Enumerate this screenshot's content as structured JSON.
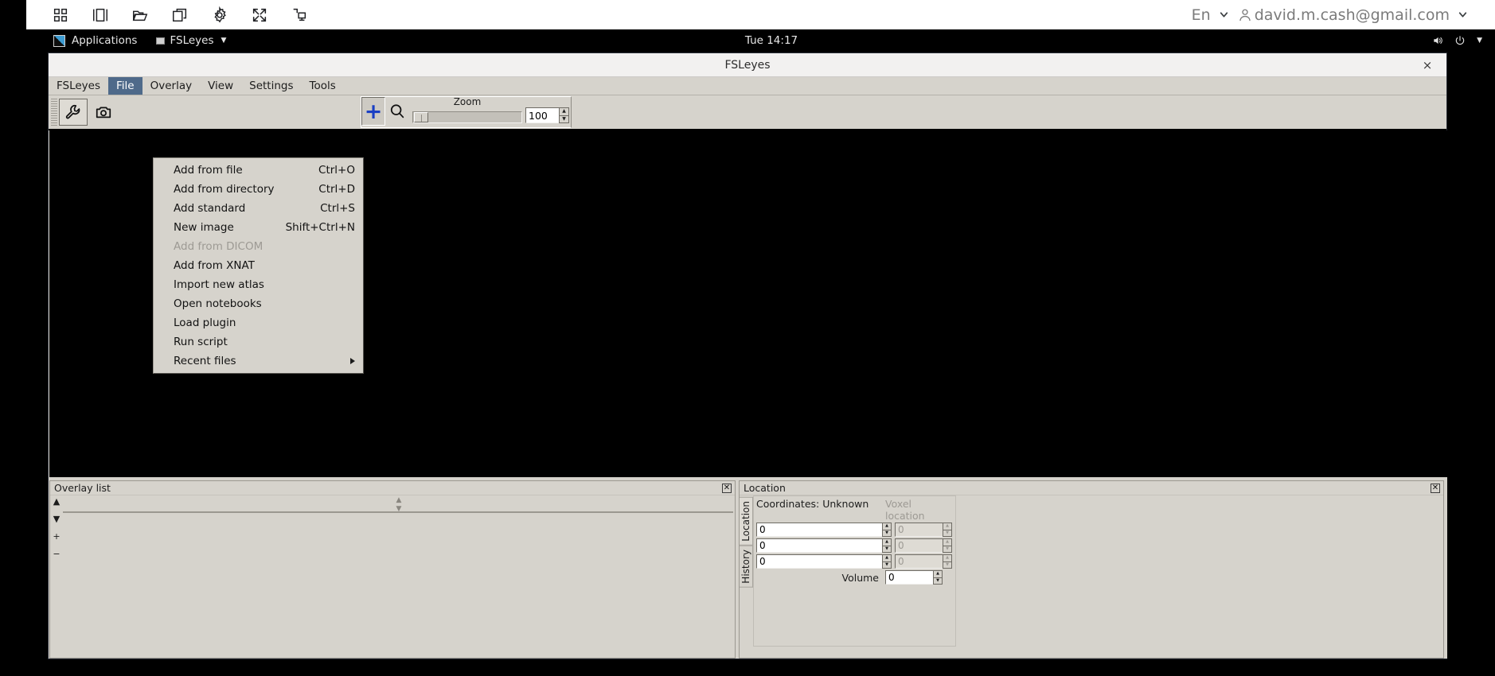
{
  "chrome": {
    "icons": [
      "apps-grid-icon",
      "split-view-icon",
      "folder-open-icon",
      "copy-window-icon",
      "gear-icon",
      "fullscreen-icon",
      "remote-desktop-icon"
    ],
    "language": "En",
    "account_email": "david.m.cash@gmail.com"
  },
  "desktop_panel": {
    "applications_label": "Applications",
    "window_button_label": "FSLeyes",
    "clock": "Tue 14:17",
    "tray_icons": [
      "volume-icon",
      "power-icon",
      "chevron-down-icon"
    ]
  },
  "window": {
    "title": "FSLeyes",
    "close_label": "×"
  },
  "menubar": {
    "items": [
      {
        "label": "FSLeyes",
        "active": false
      },
      {
        "label": "File",
        "active": true
      },
      {
        "label": "Overlay",
        "active": false
      },
      {
        "label": "View",
        "active": false
      },
      {
        "label": "Settings",
        "active": false
      },
      {
        "label": "Tools",
        "active": false
      }
    ]
  },
  "file_menu": {
    "items": [
      {
        "label": "Add from file",
        "accel": "Ctrl+O",
        "disabled": false,
        "submenu": false
      },
      {
        "label": "Add from directory",
        "accel": "Ctrl+D",
        "disabled": false,
        "submenu": false
      },
      {
        "label": "Add standard",
        "accel": "Ctrl+S",
        "disabled": false,
        "submenu": false
      },
      {
        "label": "New image",
        "accel": "Shift+Ctrl+N",
        "disabled": false,
        "submenu": false
      },
      {
        "label": "Add from DICOM",
        "accel": "",
        "disabled": true,
        "submenu": false
      },
      {
        "label": "Add from XNAT",
        "accel": "",
        "disabled": false,
        "submenu": false
      },
      {
        "label": "Import new atlas",
        "accel": "",
        "disabled": false,
        "submenu": false
      },
      {
        "label": "Open notebooks",
        "accel": "",
        "disabled": false,
        "submenu": false
      },
      {
        "label": "Load plugin",
        "accel": "",
        "disabled": false,
        "submenu": false
      },
      {
        "label": "Run script",
        "accel": "",
        "disabled": false,
        "submenu": false
      },
      {
        "label": "Recent files",
        "accel": "",
        "disabled": false,
        "submenu": true
      }
    ]
  },
  "toolbar": {
    "settings_icon": "wrench-icon",
    "screenshot_icon": "camera-icon",
    "crosshair_icon": "plus-crosshair-icon",
    "magnifier_icon": "magnifier-icon",
    "zoom_label": "Zoom",
    "zoom_value": "100",
    "zoom_percent": 100,
    "zoom_min": 0,
    "zoom_max": 1000
  },
  "overlay_pane": {
    "title": "Overlay list",
    "buttons": [
      {
        "name": "move-up-button",
        "glyph": "▲"
      },
      {
        "name": "move-down-button",
        "glyph": "▼"
      },
      {
        "name": "add-overlay-button",
        "glyph": "+"
      },
      {
        "name": "remove-overlay-button",
        "glyph": "−"
      }
    ],
    "items": [],
    "close_glyph": "✕"
  },
  "location_pane": {
    "title": "Location",
    "tabs": [
      {
        "label": "Location",
        "selected": true
      },
      {
        "label": "History",
        "selected": false
      }
    ],
    "coordinates_header": "Coordinates: Unknown",
    "voxel_header": "Voxel location",
    "world_values": [
      "0",
      "0",
      "0"
    ],
    "voxel_values": [
      "0",
      "0",
      "0"
    ],
    "volume_label": "Volume",
    "volume_value": "0",
    "close_glyph": "✕"
  },
  "colors": {
    "menu_highlight": "#4f6a8a",
    "panel_bg": "#d6d3cc",
    "canvas_bg": "#000000",
    "accent_blue": "#1a3fc4",
    "desktop_bar": "#000000"
  }
}
